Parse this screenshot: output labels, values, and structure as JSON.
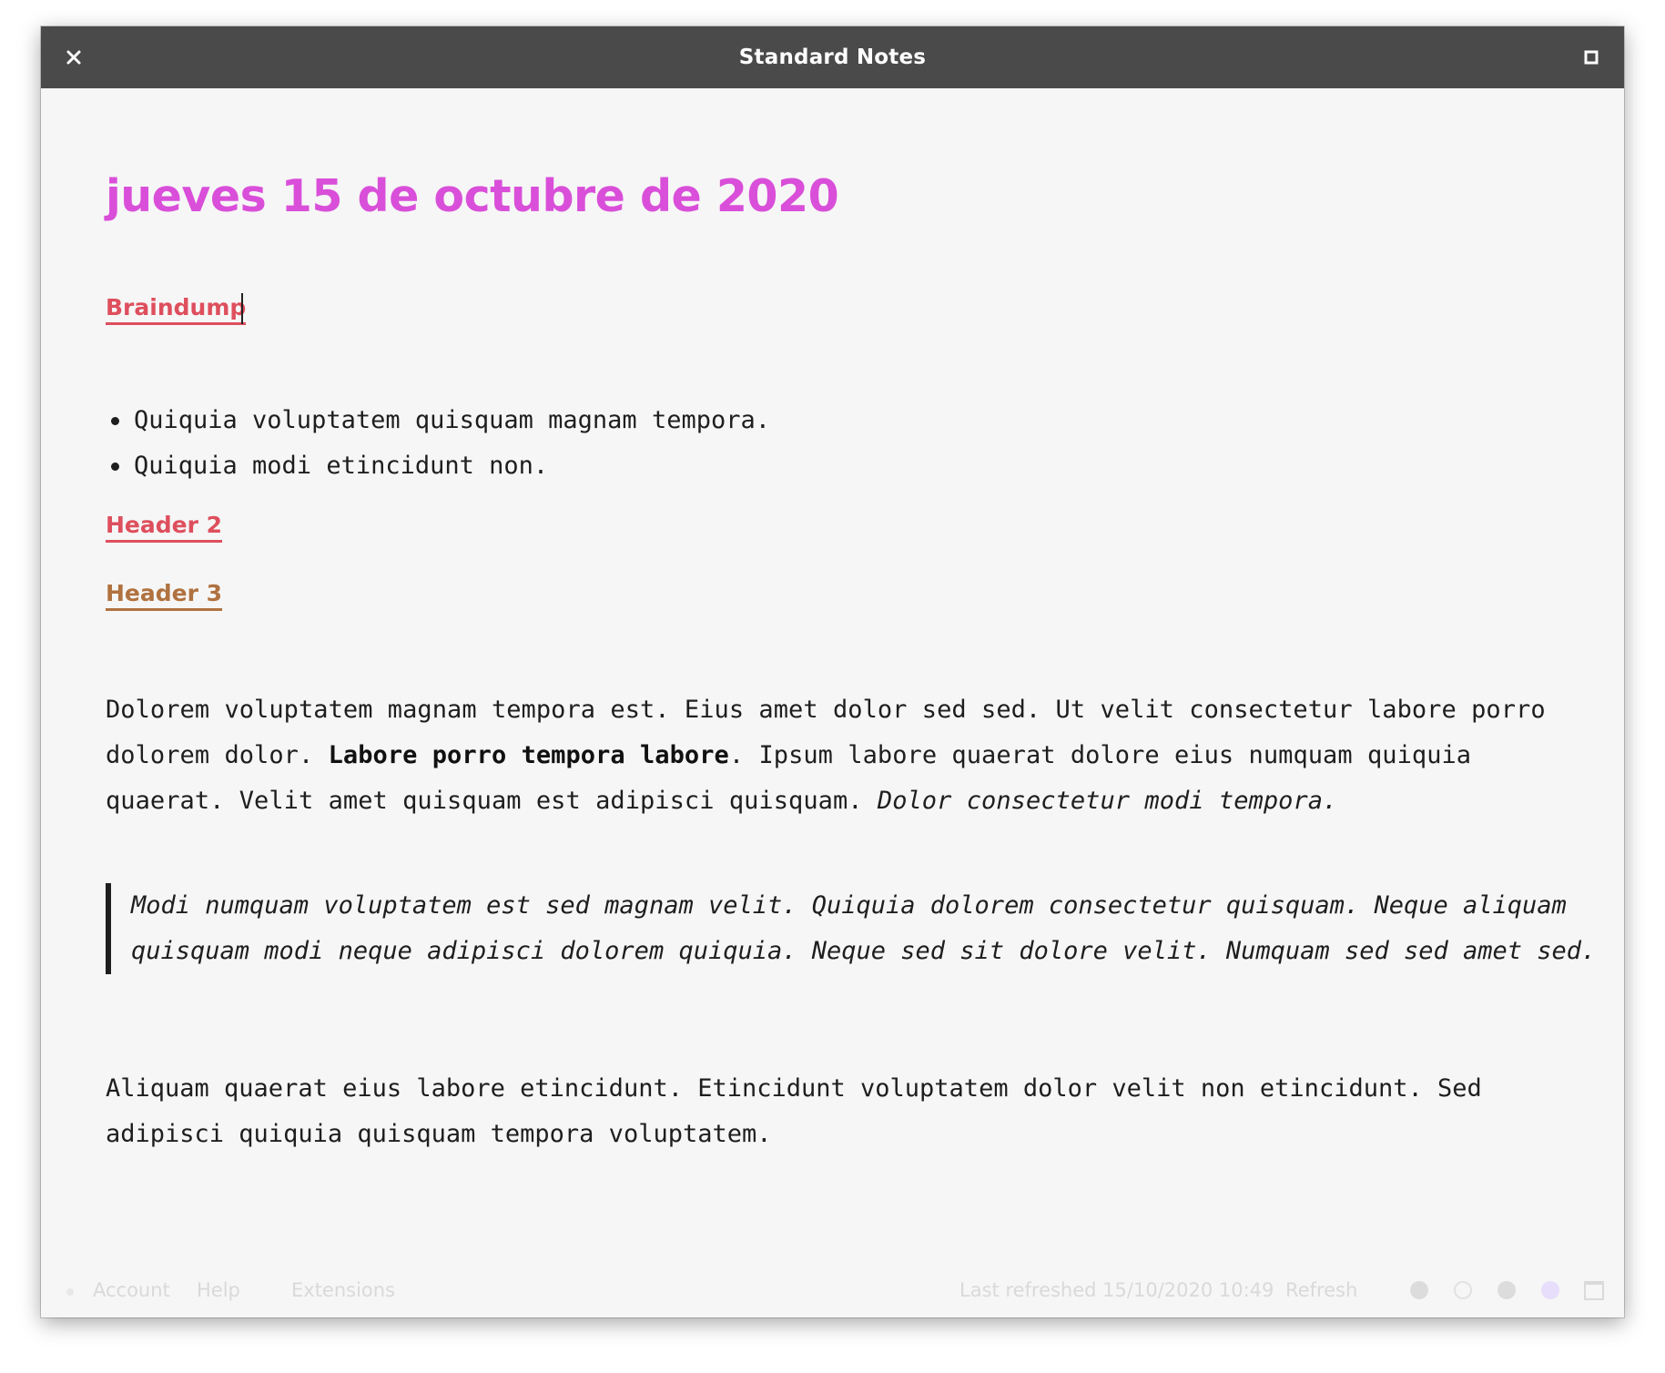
{
  "window": {
    "title": "Standard Notes"
  },
  "note": {
    "title": "jueves 15 de octubre de 2020",
    "headers": {
      "h1": "Braindump",
      "h2": "Header 2",
      "h3": "Header 3"
    },
    "bullets": [
      "Quiquia voluptatem quisquam magnam tempora.",
      "Quiquia modi etincidunt non."
    ],
    "paragraph1": {
      "part1": "Dolorem voluptatem magnam tempora est. Eius amet dolor sed sed. Ut velit consectetur labore porro dolorem dolor. ",
      "bold": "Labore porro tempora labore",
      "part2": ". Ipsum labore quaerat dolore eius numquam quiquia quaerat. Velit amet quisquam est adipisci quisquam. ",
      "italic": "Dolor consectetur modi tempora."
    },
    "blockquote": "Modi numquam voluptatem est sed magnam velit. Quiquia dolorem consectetur quisquam. Neque aliquam quisquam modi neque adipisci dolorem quiquia. Neque sed sit dolore velit. Numquam sed sed amet sed.",
    "paragraph2": "Aliquam quaerat eius labore etincidunt. Etincidunt voluptatem dolor velit non etincidunt. Sed adipisci quiquia quisquam tempora voluptatem."
  },
  "footer": {
    "account": "Account",
    "help": "Help",
    "extensions": "Extensions",
    "last_refreshed": "Last refreshed 15/10/2020 10:49",
    "refresh": "Refresh",
    "theme_dots": [
      {
        "name": "theme-dot-gray",
        "color": "#dcdcdc",
        "outline": false
      },
      {
        "name": "theme-dot-outline",
        "color": "#f6f6f6",
        "outline": true
      },
      {
        "name": "theme-dot-gray-2",
        "color": "#dcdcdc",
        "outline": false
      },
      {
        "name": "theme-dot-lavender",
        "color": "#e6defa",
        "outline": false
      }
    ]
  }
}
